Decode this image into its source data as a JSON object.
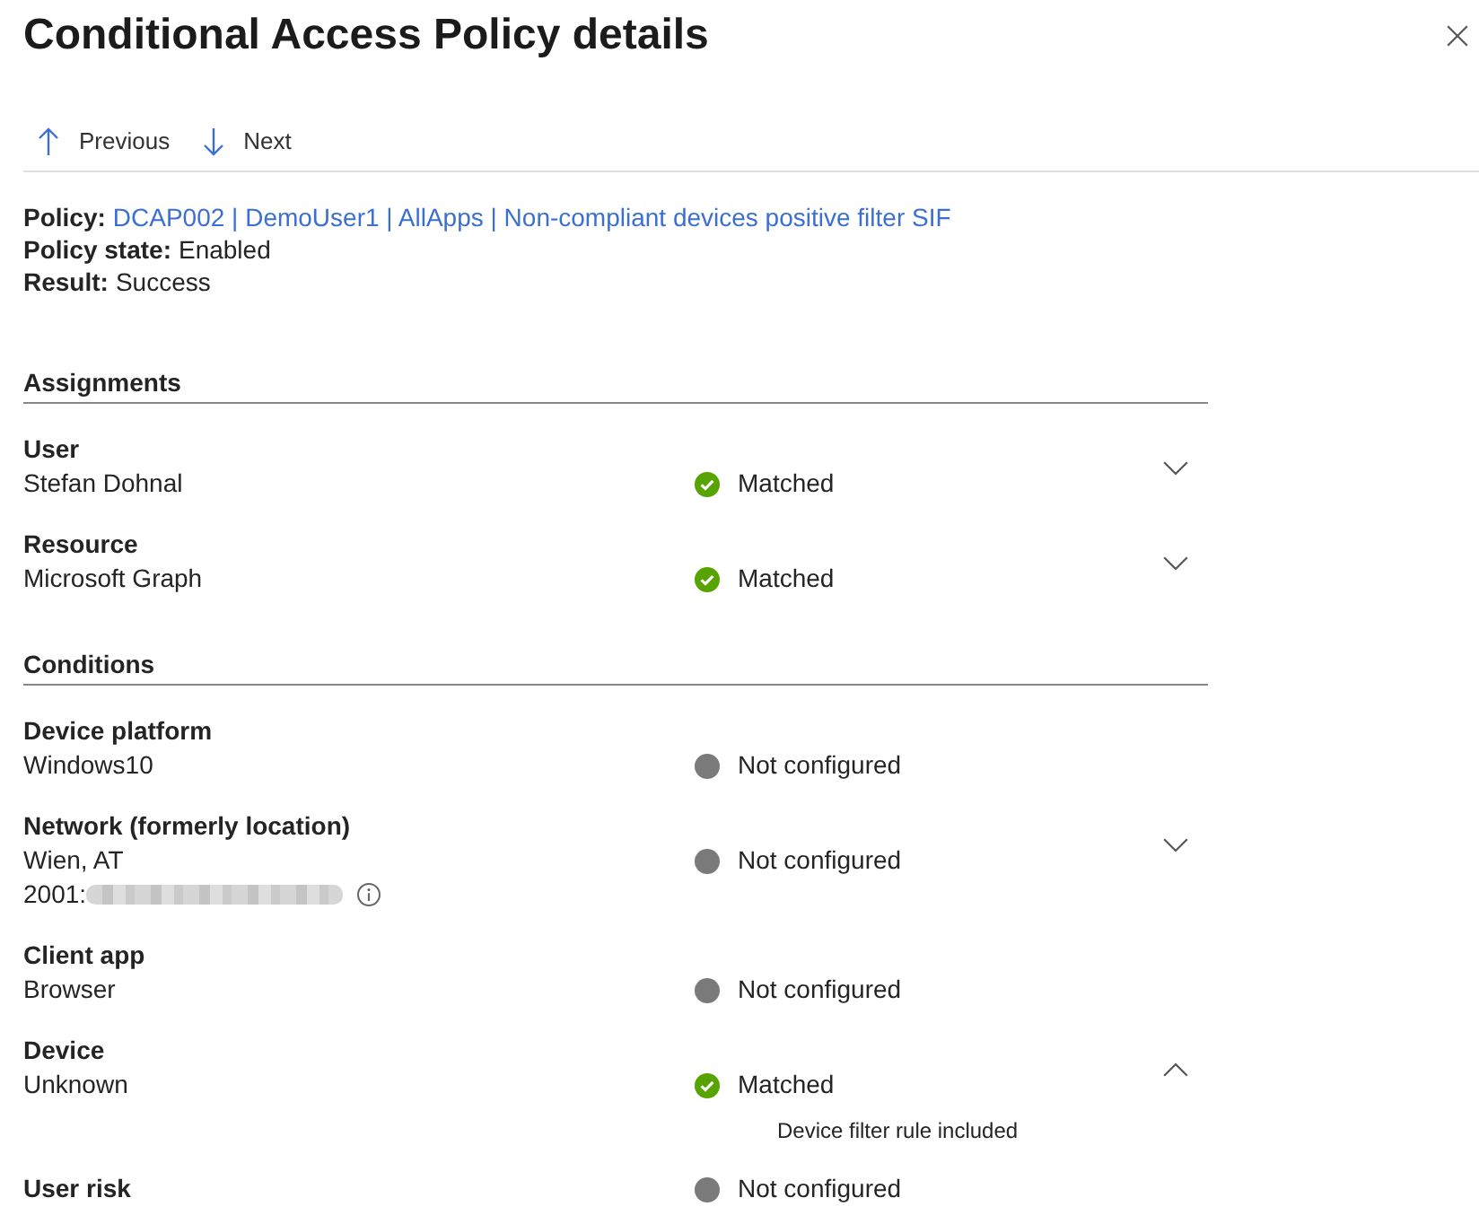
{
  "title": "Conditional Access Policy details",
  "toolbar": [
    {
      "kind": "up",
      "label": "Previous"
    },
    {
      "kind": "down",
      "label": "Next"
    }
  ],
  "summary": [
    {
      "kind": "link",
      "label": "Policy:",
      "value": "DCAP002 | DemoUser1 | AllApps | Non-compliant devices positive filter SIF"
    },
    {
      "kind": "text",
      "label": "Policy state:",
      "value": "Enabled"
    },
    {
      "kind": "text",
      "label": "Result:",
      "value": "Success"
    }
  ],
  "sections": [
    {
      "title": "Assignments",
      "rows": [
        {
          "label": "User",
          "values": [
            {
              "kind": "text",
              "text": "Stefan Dohnal"
            }
          ],
          "status": {
            "kind": "matched",
            "text": "Matched"
          },
          "expanded": false
        },
        {
          "label": "Resource",
          "values": [
            {
              "kind": "text",
              "text": "Microsoft Graph"
            }
          ],
          "status": {
            "kind": "matched",
            "text": "Matched"
          },
          "expanded": false
        }
      ]
    },
    {
      "title": "Conditions",
      "rows": [
        {
          "label": "Device platform",
          "values": [
            {
              "kind": "text",
              "text": "Windows10"
            }
          ],
          "status": {
            "kind": "not_configured",
            "text": "Not configured"
          }
        },
        {
          "label": "Network (formerly location)",
          "values": [
            {
              "kind": "text",
              "text": "Wien, AT"
            },
            {
              "kind": "redacted",
              "text": "2001:"
            }
          ],
          "status": {
            "kind": "not_configured",
            "text": "Not configured"
          },
          "expanded": false
        },
        {
          "label": "Client app",
          "values": [
            {
              "kind": "text",
              "text": "Browser"
            }
          ],
          "status": {
            "kind": "not_configured",
            "text": "Not configured"
          }
        },
        {
          "label": "Device",
          "values": [
            {
              "kind": "text",
              "text": "Unknown"
            }
          ],
          "status": {
            "kind": "matched",
            "text": "Matched"
          },
          "expanded": true,
          "details": [
            "Device filter rule included"
          ]
        },
        {
          "label": "User risk",
          "status": {
            "kind": "not_configured",
            "text": "Not configured"
          }
        }
      ]
    }
  ]
}
